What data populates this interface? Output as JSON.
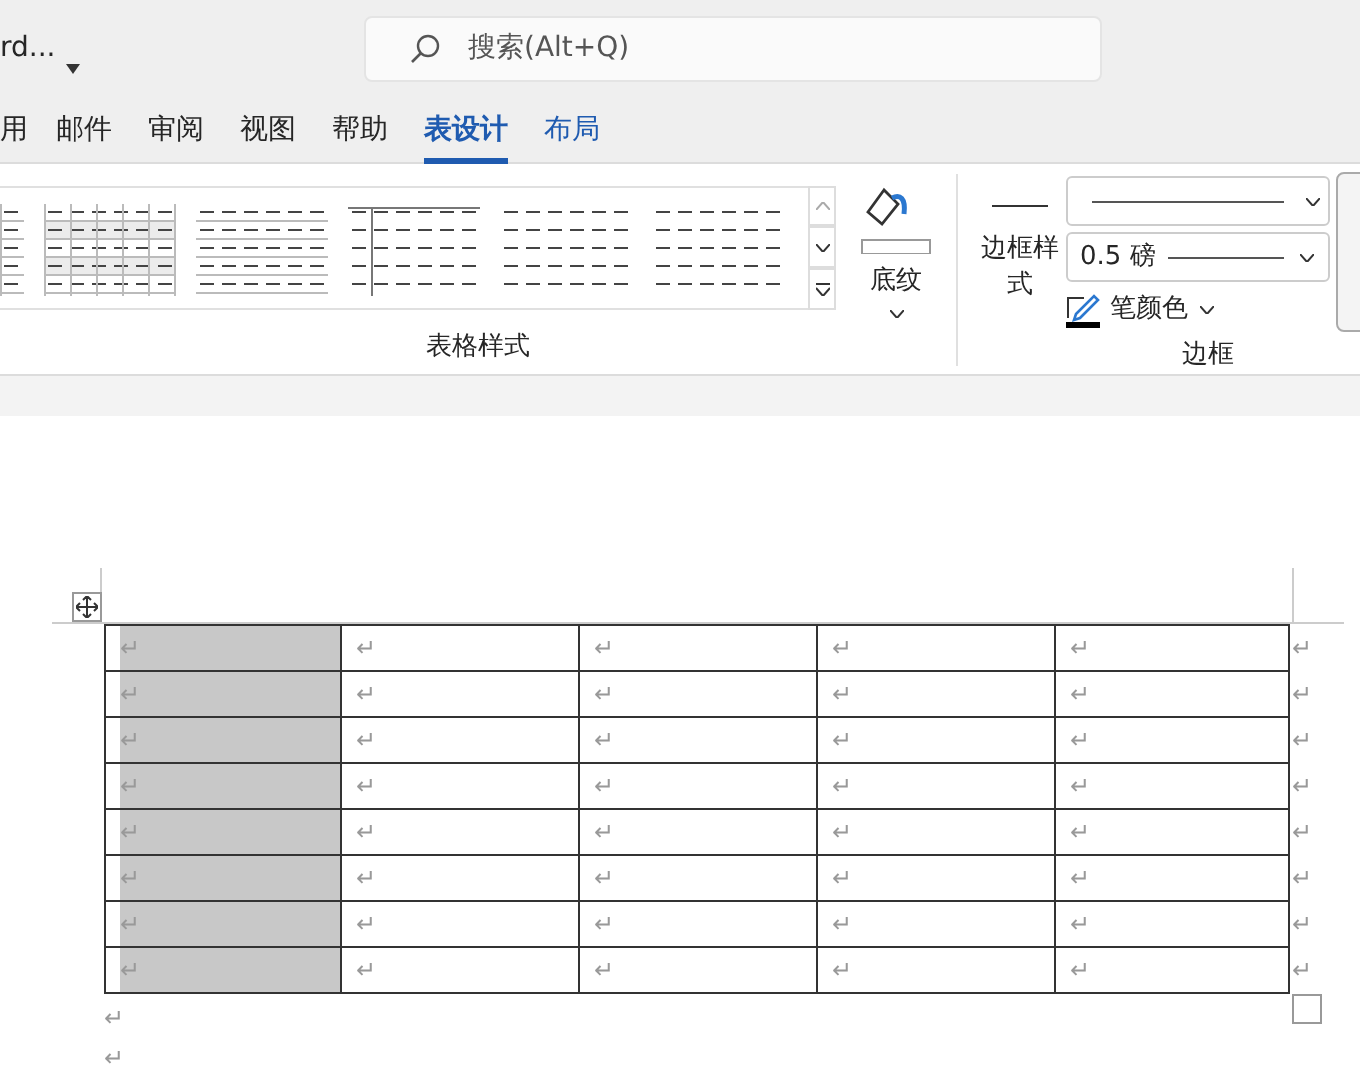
{
  "title_bar": {
    "document_name": "rd...",
    "search": {
      "placeholder": "搜索(Alt+Q)"
    }
  },
  "tabs": [
    {
      "label": "用",
      "selected": false,
      "contextual": false
    },
    {
      "label": "邮件",
      "selected": false,
      "contextual": false
    },
    {
      "label": "审阅",
      "selected": false,
      "contextual": false
    },
    {
      "label": "视图",
      "selected": false,
      "contextual": false
    },
    {
      "label": "帮助",
      "selected": false,
      "contextual": false
    },
    {
      "label": "表设计",
      "selected": true,
      "contextual": true
    },
    {
      "label": "布局",
      "selected": false,
      "contextual": true
    }
  ],
  "ribbon": {
    "table_styles": {
      "label": "表格样式"
    },
    "shading": {
      "label": "底纹"
    },
    "borders": {
      "border_styles_label": "边框样式",
      "pen_weight": "0.5 磅",
      "pen_color": "笔颜色",
      "label": "边框"
    }
  },
  "table": {
    "rows": [
      {
        "cells": [
          {
            "text": "↵",
            "selected": true
          },
          {
            "text": "↵",
            "selected": false
          },
          {
            "text": "↵",
            "selected": false
          },
          {
            "text": "↵",
            "selected": false
          },
          {
            "text": "↵",
            "selected": false
          }
        ],
        "end_mark": "↵"
      },
      {
        "cells": [
          {
            "text": "↵",
            "selected": true
          },
          {
            "text": "↵",
            "selected": false
          },
          {
            "text": "↵",
            "selected": false
          },
          {
            "text": "↵",
            "selected": false
          },
          {
            "text": "↵",
            "selected": false
          }
        ],
        "end_mark": "↵"
      },
      {
        "cells": [
          {
            "text": "↵",
            "selected": true
          },
          {
            "text": "↵",
            "selected": false
          },
          {
            "text": "↵",
            "selected": false
          },
          {
            "text": "↵",
            "selected": false
          },
          {
            "text": "↵",
            "selected": false
          }
        ],
        "end_mark": "↵"
      },
      {
        "cells": [
          {
            "text": "↵",
            "selected": true
          },
          {
            "text": "↵",
            "selected": false
          },
          {
            "text": "↵",
            "selected": false
          },
          {
            "text": "↵",
            "selected": false
          },
          {
            "text": "↵",
            "selected": false
          }
        ],
        "end_mark": "↵"
      },
      {
        "cells": [
          {
            "text": "↵",
            "selected": true
          },
          {
            "text": "↵",
            "selected": false
          },
          {
            "text": "↵",
            "selected": false
          },
          {
            "text": "↵",
            "selected": false
          },
          {
            "text": "↵",
            "selected": false
          }
        ],
        "end_mark": "↵"
      },
      {
        "cells": [
          {
            "text": "↵",
            "selected": true
          },
          {
            "text": "↵",
            "selected": false
          },
          {
            "text": "↵",
            "selected": false
          },
          {
            "text": "↵",
            "selected": false
          },
          {
            "text": "↵",
            "selected": false
          }
        ],
        "end_mark": "↵"
      },
      {
        "cells": [
          {
            "text": "↵",
            "selected": true
          },
          {
            "text": "↵",
            "selected": false
          },
          {
            "text": "↵",
            "selected": false
          },
          {
            "text": "↵",
            "selected": false
          },
          {
            "text": "↵",
            "selected": false
          }
        ],
        "end_mark": "↵"
      },
      {
        "cells": [
          {
            "text": "↵",
            "selected": true
          },
          {
            "text": "↵",
            "selected": false
          },
          {
            "text": "↵",
            "selected": false
          },
          {
            "text": "↵",
            "selected": false
          },
          {
            "text": "↵",
            "selected": false
          }
        ],
        "end_mark": "↵"
      }
    ]
  },
  "after_table": [
    "↵",
    "↵"
  ]
}
